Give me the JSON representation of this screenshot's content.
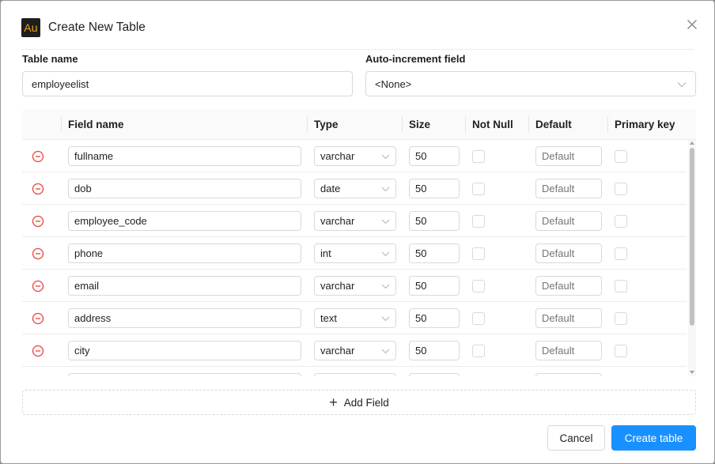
{
  "dialog": {
    "logo_text": "Au",
    "title": "Create New Table",
    "close_icon": "close-icon"
  },
  "form": {
    "table_name_label": "Table name",
    "table_name_value": "employeelist",
    "auto_increment_label": "Auto-increment field",
    "auto_increment_value": "<None>"
  },
  "grid": {
    "headers": {
      "field_name": "Field name",
      "type": "Type",
      "size": "Size",
      "not_null": "Not Null",
      "default": "Default",
      "primary_key": "Primary key"
    },
    "default_placeholder": "Default",
    "rows": [
      {
        "name": "fullname",
        "type": "varchar",
        "size": "50"
      },
      {
        "name": "dob",
        "type": "date",
        "size": "50"
      },
      {
        "name": "employee_code",
        "type": "varchar",
        "size": "50"
      },
      {
        "name": "phone",
        "type": "int",
        "size": "50"
      },
      {
        "name": "email",
        "type": "varchar",
        "size": "50"
      },
      {
        "name": "address",
        "type": "text",
        "size": "50"
      },
      {
        "name": "city",
        "type": "varchar",
        "size": "50"
      },
      {
        "name": "",
        "type": "",
        "size": ""
      }
    ]
  },
  "actions": {
    "add_field": "Add Field",
    "cancel": "Cancel",
    "create": "Create table"
  },
  "colors": {
    "primary": "#1890ff",
    "remove": "#e8453c",
    "logo_bg": "#1e1e1e",
    "logo_fg": "#f0a21e"
  }
}
